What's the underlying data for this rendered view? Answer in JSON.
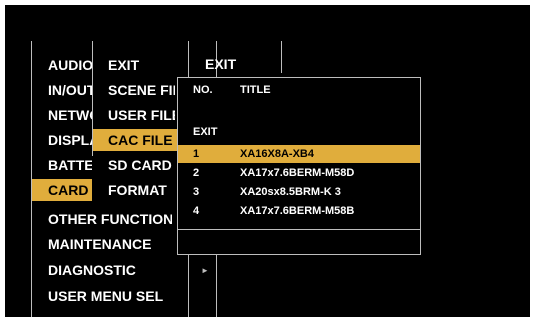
{
  "colors": {
    "highlight": "#e0ad3c",
    "background": "#000000",
    "text": "#ffffff",
    "divider": "#bdbdbd"
  },
  "main_menu": {
    "items": [
      {
        "label": "AUDIO"
      },
      {
        "label": "IN/OUT"
      },
      {
        "label": "NETWORK"
      },
      {
        "label": "DISPLAY"
      },
      {
        "label": "BATTERY"
      },
      {
        "label": "CARD",
        "selected": true
      },
      {
        "label": "OTHER FUNCTIONS"
      },
      {
        "label": "MAINTENANCE"
      },
      {
        "label": "DIAGNOSTIC"
      },
      {
        "label": "USER MENU SEL"
      }
    ]
  },
  "sub_menu": {
    "items": [
      {
        "label": "EXIT"
      },
      {
        "label": "SCENE FILE"
      },
      {
        "label": "USER FILE"
      },
      {
        "label": "CAC FILE",
        "selected": true
      },
      {
        "label": "SD CARD"
      },
      {
        "label": "FORMAT"
      }
    ]
  },
  "third_menu": {
    "header": "EXIT"
  },
  "popup": {
    "col_no": "NO.",
    "col_title": "TITLE",
    "exit_label": "EXIT",
    "rows": [
      {
        "no": "1",
        "title": "XA16X8A-XB4",
        "selected": true
      },
      {
        "no": "2",
        "title": "XA17x7.6BERM-M58D"
      },
      {
        "no": "3",
        "title": "XA20sx8.5BRM-K 3"
      },
      {
        "no": "4",
        "title": "XA17x7.6BERM-M58B"
      }
    ]
  },
  "icons": {
    "submenu_arrow": "►"
  }
}
